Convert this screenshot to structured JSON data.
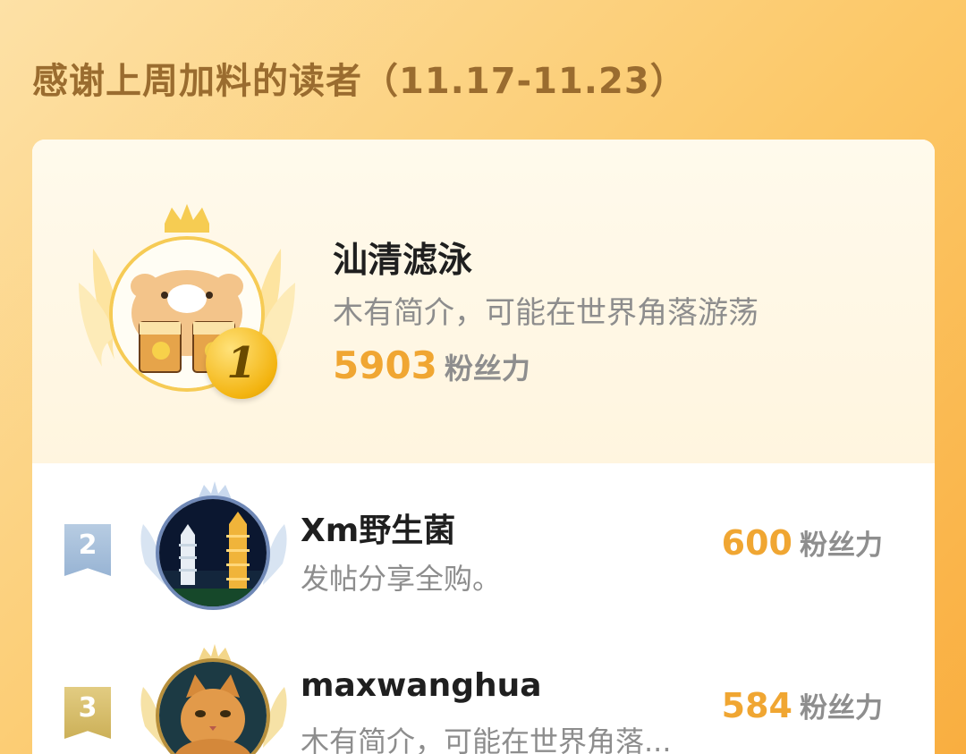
{
  "header": {
    "title": "感谢上周加料的读者（11.17-11.23）"
  },
  "colors": {
    "accent": "#f0a632",
    "gold": "#f3b410",
    "silver": "#98b4d4",
    "bronze": "#ccb058",
    "muted": "#8d8d8d"
  },
  "readers": [
    {
      "rank": "1",
      "name": "汕清滤泳",
      "bio": "木有简介，可能在世界角落游荡",
      "score": "5903",
      "unit": "粉丝力",
      "avatar_icon": "hamster-avatar-icon"
    },
    {
      "rank": "2",
      "name": "Xm野生菌",
      "bio": "发帖分享全购。",
      "score": "600",
      "unit": "粉丝力",
      "avatar_icon": "pagoda-night-avatar-icon"
    },
    {
      "rank": "3",
      "name": "maxwanghua",
      "bio": "木有简介，可能在世界角落...",
      "score": "584",
      "unit": "粉丝力",
      "avatar_icon": "cat-avatar-icon"
    }
  ]
}
